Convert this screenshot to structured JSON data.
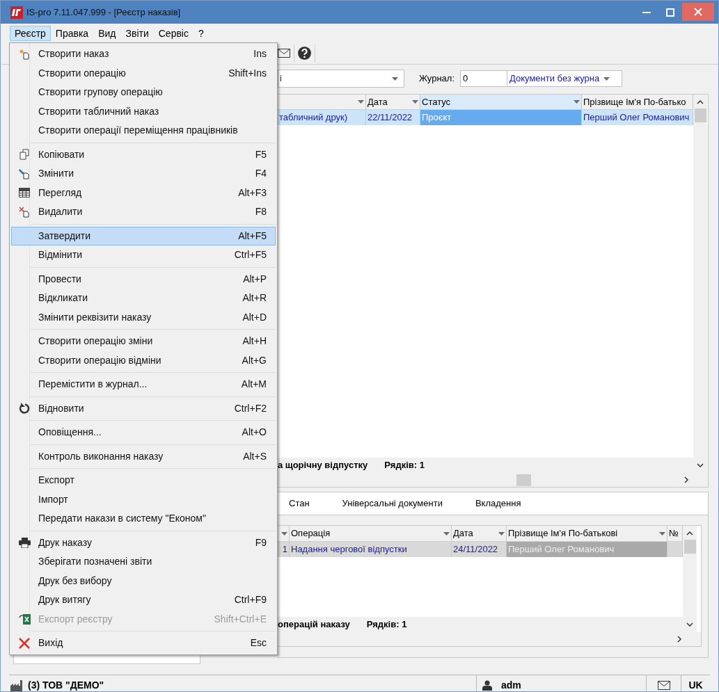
{
  "window": {
    "title": "IS-pro 7.11.047.999 - [Реєстр наказів]"
  },
  "menu_bar": [
    {
      "label": "Реєстр",
      "selected": true
    },
    {
      "label": "Правка",
      "selected": false
    },
    {
      "label": "Вид",
      "selected": false
    },
    {
      "label": "Звіти",
      "selected": false
    },
    {
      "label": "Сервіс",
      "selected": false
    },
    {
      "label": "?",
      "selected": false
    }
  ],
  "menu": [
    [
      {
        "label": "Створити наказ",
        "shortcut": "Ins",
        "kind": "new",
        "disabled": false,
        "selected": false
      },
      {
        "label": "Створити операцію",
        "shortcut": "Shift+Ins",
        "disabled": false,
        "selected": false
      },
      {
        "label": "Створити групову операцію",
        "disabled": false,
        "selected": false
      },
      {
        "label": "Створити табличний наказ",
        "disabled": false,
        "selected": false
      },
      {
        "label": "Створити операції переміщення працівників",
        "disabled": false,
        "selected": false
      }
    ],
    [
      {
        "label": "Копіювати",
        "shortcut": "F5",
        "kind": "copy",
        "disabled": false,
        "selected": false
      },
      {
        "label": "Змінити",
        "shortcut": "F4",
        "kind": "edit",
        "disabled": false,
        "selected": false
      },
      {
        "label": "Перегляд",
        "shortcut": "Alt+F3",
        "kind": "table",
        "disabled": false,
        "selected": false
      },
      {
        "label": "Видалити",
        "shortcut": "F8",
        "kind": "delete",
        "disabled": false,
        "selected": false
      }
    ],
    [
      {
        "label": "Затвердити",
        "shortcut": "Alt+F5",
        "disabled": false,
        "selected": true
      },
      {
        "label": "Відмінити",
        "shortcut": "Ctrl+F5",
        "disabled": false,
        "selected": false
      }
    ],
    [
      {
        "label": "Провести",
        "shortcut": "Alt+P",
        "disabled": false,
        "selected": false
      },
      {
        "label": "Відкликати",
        "shortcut": "Alt+R",
        "disabled": false,
        "selected": false
      },
      {
        "label": "Змінити реквізити наказу",
        "shortcut": "Alt+D",
        "disabled": false,
        "selected": false
      }
    ],
    [
      {
        "label": "Створити операцію зміни",
        "shortcut": "Alt+H",
        "disabled": false,
        "selected": false
      },
      {
        "label": "Створити операцію відміни",
        "shortcut": "Alt+G",
        "disabled": false,
        "selected": false
      }
    ],
    [
      {
        "label": "Перемістити в журнал...",
        "shortcut": "Alt+M",
        "disabled": false,
        "selected": false
      }
    ],
    [
      {
        "label": "Відновити",
        "shortcut": "Ctrl+F2",
        "kind": "restore",
        "disabled": false,
        "selected": false
      }
    ],
    [
      {
        "label": "Оповіщення...",
        "shortcut": "Alt+O",
        "disabled": false,
        "selected": false
      }
    ],
    [
      {
        "label": "Контроль виконання наказу",
        "shortcut": "Alt+S",
        "disabled": false,
        "selected": false
      }
    ],
    [
      {
        "label": "Експорт",
        "disabled": false,
        "selected": false
      },
      {
        "label": "Імпорт",
        "disabled": false,
        "selected": false
      },
      {
        "label": "Передати накази в систему \"Економ\"",
        "disabled": false,
        "selected": false
      }
    ],
    [
      {
        "label": "Друк наказу",
        "shortcut": "F9",
        "kind": "print",
        "disabled": false,
        "selected": false
      },
      {
        "label": "Зберігати позначені звіти",
        "disabled": false,
        "selected": false
      },
      {
        "label": "Друк без вибору",
        "disabled": false,
        "selected": false
      },
      {
        "label": "Друк витягу",
        "shortcut": "Ctrl+F9",
        "disabled": false,
        "selected": false
      },
      {
        "label": "Експорт реєстру",
        "shortcut": "Shift+Ctrl+E",
        "kind": "excel",
        "disabled": true,
        "selected": false
      }
    ],
    [
      {
        "label": "Вихід",
        "shortcut": "Esc",
        "kind": "exit",
        "disabled": false,
        "selected": false
      }
    ]
  ],
  "filter": {
    "value": "і",
    "journal_label": "Журнал:",
    "journal_number": "0",
    "journal_name": "Документи без журна"
  },
  "orders_table": {
    "columns": [
      null,
      "Дата",
      "Статус",
      "Прізвище Ім'я По-батько"
    ],
    "rows": [
      {
        "selected": true,
        "cells": [
          {
            "text": "табличний друк)",
            "focused": false
          },
          {
            "text": "22/11/2022",
            "focused": false
          },
          {
            "text": "Проєкт",
            "focused": true
          },
          {
            "text": "Перший Олег Романович",
            "focused": false
          }
        ]
      }
    ],
    "footer": {
      "title": "а щорічну відпустку",
      "count": "Рядків: 1"
    }
  },
  "tabs": [
    {
      "label": "Стан",
      "selected": false
    },
    {
      "label": "Універсальні документи",
      "selected": false
    },
    {
      "label": "Вкладення",
      "selected": false
    }
  ],
  "operations_table": {
    "columns": [
      null,
      "Операція",
      "Дата",
      "Прізвище Ім'я По-батькові",
      "№"
    ],
    "rows": [
      {
        "selected": true,
        "cells": [
          {
            "text": "1",
            "focused": false
          },
          {
            "text": "Надання чергової відпустки",
            "focused": false
          },
          {
            "text": "24/11/2022",
            "focused": false
          },
          {
            "text": "Перший Олег Романович",
            "focused": true
          },
          {
            "focused": false
          }
        ]
      }
    ],
    "footer": {
      "title": "операцій наказу",
      "count": "Рядків: 1"
    }
  },
  "status_bar": {
    "organization": "(3) ТОВ \"ДЕМО\"",
    "user": "adm",
    "language": "UK"
  }
}
